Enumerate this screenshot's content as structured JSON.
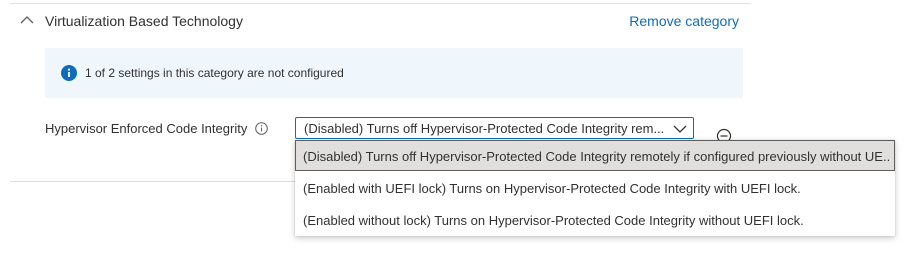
{
  "category": {
    "title": "Virtualization Based Technology",
    "remove_label": "Remove category"
  },
  "banner": {
    "text": "1 of 2 settings in this category are not configured",
    "icon": "info-icon"
  },
  "setting": {
    "label": "Hypervisor Enforced Code Integrity",
    "selected_value": "(Disabled) Turns off Hypervisor-Protected Code Integrity rem...",
    "options": [
      "(Disabled) Turns off Hypervisor-Protected Code Integrity remotely if configured previously without UE...",
      "(Enabled with UEFI lock) Turns on Hypervisor-Protected Code Integrity with UEFI lock.",
      "(Enabled without lock) Turns on Hypervisor-Protected Code Integrity without UEFI lock."
    ]
  },
  "colors": {
    "accent": "#0f6cbd",
    "banner_bg": "#eff6fc",
    "selected_option_bg": "#e1dfdd"
  }
}
